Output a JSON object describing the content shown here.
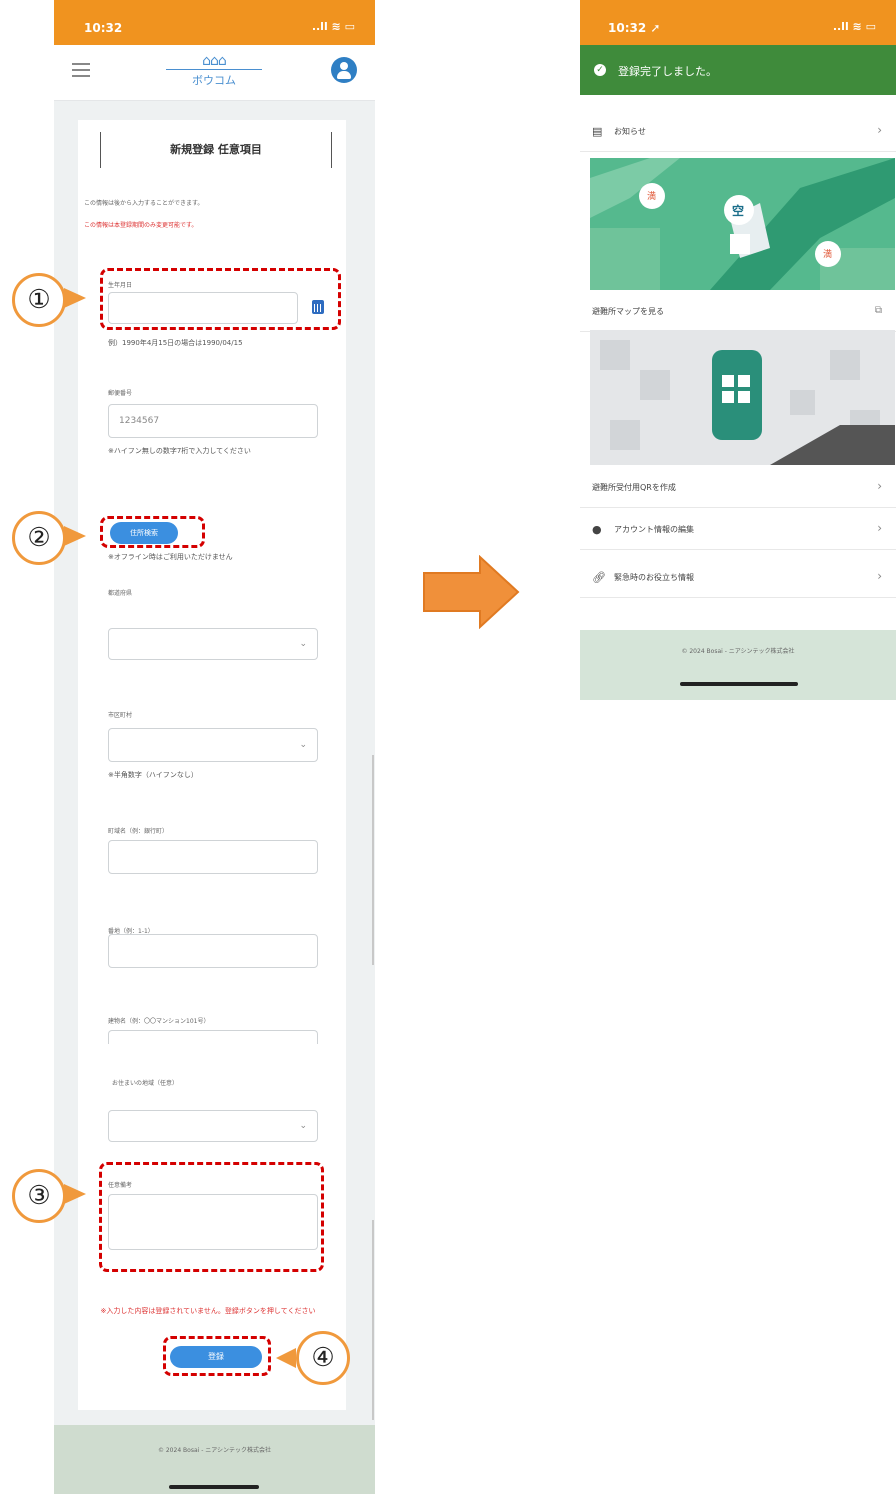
{
  "colors": {
    "accent_orange": "#f0931f",
    "primary_blue": "#3b8fe0",
    "success_green": "#3f8b3b",
    "annotation_red": "#d40000",
    "footer_green": "#cfdccf"
  },
  "registration_screen": {
    "status_bar": {
      "time": "10:32",
      "system": "..ll ≋ ▭"
    },
    "app_bar": {
      "logo_text": "ボウコム",
      "menu_icon": "hamburger-icon",
      "account_icon": "account-icon"
    },
    "card_title": "新規登録  任意項目",
    "intro_note": "この情報は後から入力することができます。",
    "warning_note": "この情報は本登録期間のみ変更可能です。",
    "birthday": {
      "label": "生年月日",
      "value": "",
      "hint": "例）1990年4月15日の場合は1990/04/15"
    },
    "postal_code": {
      "label": "郵便番号",
      "value": "1234567",
      "hint": "※ハイフン無しの数字7桁で入力してください"
    },
    "address_search_button": "住所検索",
    "address_search_hint": "※オフライン時はご利用いただけません",
    "prefecture": {
      "label": "都道府県",
      "value": ""
    },
    "city": {
      "label": "市区町村",
      "value": "",
      "hint": "※半角数字（ハイフンなし）"
    },
    "town": {
      "label": "町域名（例：銀行町）",
      "value": ""
    },
    "block": {
      "label": "番地（例：1-1）",
      "value": ""
    },
    "building": {
      "label": "建物名（例：〇〇マンション101号）",
      "value": ""
    },
    "district": {
      "label": "お住まいの地域（任意）",
      "value": ""
    },
    "remarks": {
      "label": "任意備考",
      "value": ""
    },
    "error_text": "※入力した内容は登録されていません。登録ボタンを押してください",
    "register_button": "登録",
    "footer": "© 2024 Bosai - ニアシンテック株式会社"
  },
  "annotations": [
    "①",
    "②",
    "③",
    "④"
  ],
  "complete_screen": {
    "status_bar": {
      "time": "10:32 ➚",
      "system": "..ll ≋ ▭"
    },
    "banner": "登録完了しました。",
    "rows": [
      {
        "icon": "news-icon",
        "label": "お知らせ"
      },
      {
        "icon": "external-link-icon",
        "label": "避難所マップを見る"
      },
      {
        "icon": "qr-icon",
        "label": "避難所受付用QRを作成"
      },
      {
        "icon": "account-icon",
        "label": "アカウント情報の編集"
      },
      {
        "icon": "link-icon",
        "label": "緊急時のお役立ち情報"
      }
    ],
    "map_badges": [
      "満",
      "空",
      "満"
    ],
    "footer": "© 2024 Bosai - ニアシンテック株式会社"
  }
}
